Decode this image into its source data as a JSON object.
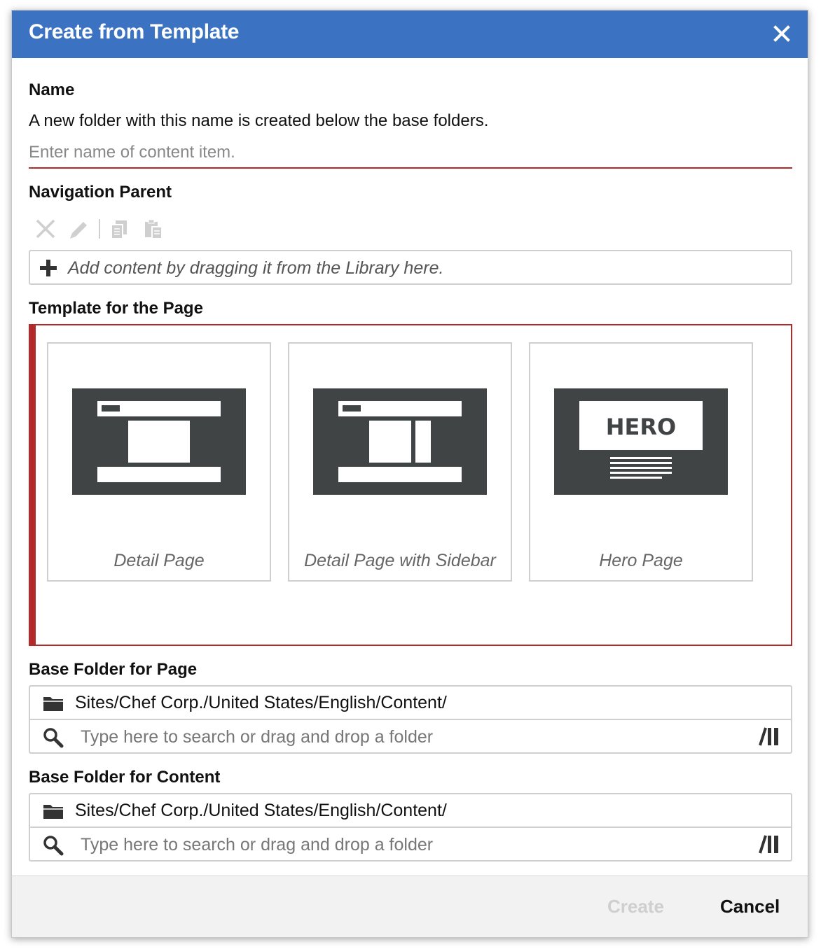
{
  "dialog": {
    "title": "Create from Template",
    "close_icon": "close-icon"
  },
  "name": {
    "label": "Name",
    "description": "A new folder with this name is created below the base folders.",
    "placeholder": "Enter name of content item.",
    "value": ""
  },
  "navigation": {
    "label": "Navigation Parent",
    "toolbar_icons": [
      "remove-icon",
      "edit-icon",
      "copy-icon",
      "paste-icon"
    ],
    "drop_hint": "Add content by dragging it from the Library here."
  },
  "template": {
    "label": "Template for the Page",
    "cards": [
      {
        "label": "Detail Page",
        "icon": "detail-page-icon"
      },
      {
        "label": "Detail Page with Sidebar",
        "icon": "detail-page-sidebar-icon"
      },
      {
        "label": "Hero Page",
        "icon": "hero-page-icon",
        "hero_text": "HERO"
      }
    ]
  },
  "base_folder_page": {
    "label": "Base Folder for Page",
    "path": "Sites/Chef Corp./United States/English/Content/",
    "search_placeholder": "Type here to search or drag and drop a folder"
  },
  "base_folder_content": {
    "label": "Base Folder for Content",
    "path": "Sites/Chef Corp./United States/English/Content/",
    "search_placeholder": "Type here to search or drag and drop a folder"
  },
  "footer": {
    "create_label": "Create",
    "cancel_label": "Cancel"
  },
  "colors": {
    "title_bar": "#3b72c2",
    "error_red": "#b22a2a",
    "template_dark": "#404445",
    "disabled": "#cfcfcf"
  }
}
